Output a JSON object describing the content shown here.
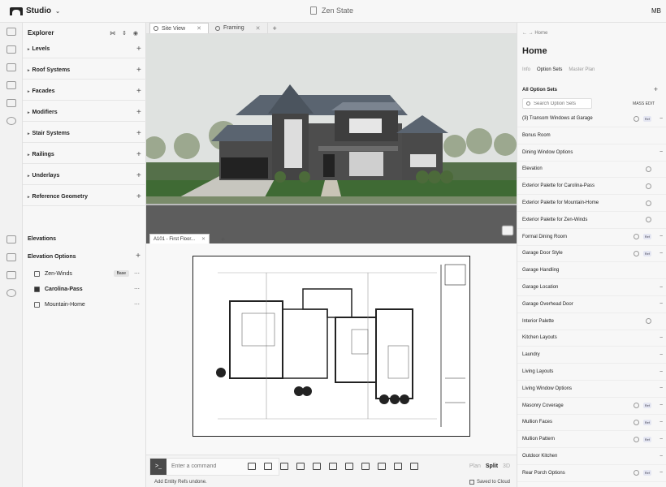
{
  "app": {
    "name": "Studio",
    "document_title": "Zen State",
    "user_initials": "MB"
  },
  "explorer": {
    "title": "Explorer",
    "groups": [
      "Levels",
      "Roof Systems",
      "Facades",
      "Modifiers",
      "Stair Systems",
      "Railings",
      "Underlays",
      "Reference Geometry"
    ],
    "elevations_title": "Elevations",
    "elevation_options_title": "Elevation Options",
    "elevation_items": [
      {
        "label": "Zen-Winds",
        "tag": "Base"
      },
      {
        "label": "Carolina-Pass",
        "tag": ""
      },
      {
        "label": "Mountain-Home",
        "tag": ""
      }
    ]
  },
  "tabs": [
    {
      "label": "Site View"
    },
    {
      "label": "Framing"
    }
  ],
  "drawing_tab": "A101 - First Floor...",
  "command": {
    "placeholder": "Enter a command"
  },
  "view_modes": [
    "Plan",
    "Split",
    "3D"
  ],
  "status": {
    "message": "Add Entity Refs undone.",
    "saved": "Saved to Cloud"
  },
  "right_panel": {
    "breadcrumb": "Home",
    "title": "Home",
    "tabs": [
      "Info",
      "Option Sets",
      "Master Plan"
    ],
    "all_option_sets": "All Option Sets",
    "search_placeholder": "Search Option Sets",
    "mass_edit": "MASS EDIT",
    "ref_badge": "Ref",
    "options": [
      {
        "label": "(3) Transom Windows at Garage",
        "info": true,
        "ref": true,
        "ctl": "−"
      },
      {
        "label": "Bonus Room",
        "info": false,
        "ref": false,
        "ctl": ""
      },
      {
        "label": "Dining Window Options",
        "info": false,
        "ref": false,
        "ctl": "−"
      },
      {
        "label": "Elevation",
        "info": true,
        "ref": false,
        "ctl": ""
      },
      {
        "label": "Exterior Palette for Carolina-Pass",
        "info": true,
        "ref": false,
        "ctl": ""
      },
      {
        "label": "Exterior Palette for Mountain-Home",
        "info": true,
        "ref": false,
        "ctl": ""
      },
      {
        "label": "Exterior Palette for Zen-Winds",
        "info": true,
        "ref": false,
        "ctl": ""
      },
      {
        "label": "Formal Dining Room",
        "info": true,
        "ref": true,
        "ctl": "−"
      },
      {
        "label": "Garage Door Style",
        "info": true,
        "ref": true,
        "ctl": "−"
      },
      {
        "label": "Garage Handling",
        "info": false,
        "ref": false,
        "ctl": ""
      },
      {
        "label": "Garage Location",
        "info": false,
        "ref": false,
        "ctl": "−"
      },
      {
        "label": "Garage Overhead Door",
        "info": false,
        "ref": false,
        "ctl": "−"
      },
      {
        "label": "Interior Palette",
        "info": true,
        "ref": false,
        "ctl": ""
      },
      {
        "label": "Kitchen Layouts",
        "info": false,
        "ref": false,
        "ctl": "−"
      },
      {
        "label": "Laundry",
        "info": false,
        "ref": false,
        "ctl": "−"
      },
      {
        "label": "Living Layouts",
        "info": false,
        "ref": false,
        "ctl": "−"
      },
      {
        "label": "Living Window Options",
        "info": false,
        "ref": false,
        "ctl": "−"
      },
      {
        "label": "Masonry Coverage",
        "info": true,
        "ref": true,
        "ctl": "−"
      },
      {
        "label": "Mullion Faces",
        "info": true,
        "ref": true,
        "ctl": "−"
      },
      {
        "label": "Mullion Pattern",
        "info": true,
        "ref": true,
        "ctl": "−"
      },
      {
        "label": "Outdoor Kitchen",
        "info": false,
        "ref": false,
        "ctl": "−"
      },
      {
        "label": "Rear Porch Options",
        "info": true,
        "ref": true,
        "ctl": "−"
      }
    ]
  },
  "colors": {
    "sky": "#dfe2e0",
    "grass": "#3f6a34",
    "road": "#5d5d5d",
    "roof": "#5a6470",
    "siding": "#4a4a4a",
    "ref_badge": "#e4e6f2"
  },
  "icons": [
    "studio-logo-icon",
    "document-icon",
    "search-icon",
    "info-icon",
    "plus-icon",
    "minus-icon",
    "close-icon",
    "house-icon"
  ]
}
